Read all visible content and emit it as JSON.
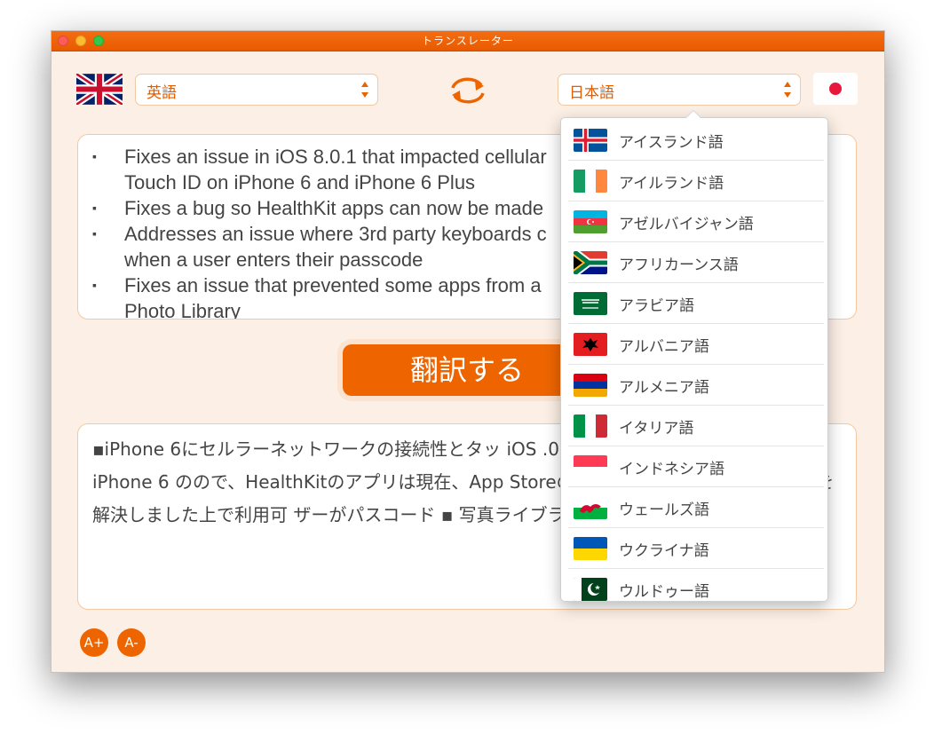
{
  "window": {
    "title": "トランスレーター"
  },
  "source_language": {
    "label": "英語",
    "flag_icon": "uk-flag-icon"
  },
  "target_language": {
    "label": "日本語",
    "flag_icon": "japan-flag-icon"
  },
  "source_text": {
    "lines": [
      {
        "bullet": "▪",
        "text": "Fixes an issue in iOS 8.0.1 that impacted cellular"
      },
      {
        "bullet": "",
        "text": "Touch ID on iPhone 6 and iPhone 6 Plus"
      },
      {
        "bullet": "▪",
        "text": "Fixes a bug so HealthKit apps can now be made"
      },
      {
        "bullet": "▪",
        "text": "Addresses an issue where 3rd party keyboards c"
      },
      {
        "bullet": "",
        "text": "when a user enters their passcode"
      },
      {
        "bullet": "▪",
        "text": "Fixes an issue that prevented some apps from a"
      },
      {
        "bullet": "",
        "text": "Photo Library"
      }
    ]
  },
  "translate_button": {
    "label": "翻訳する"
  },
  "output_text": {
    "text": "▪iPhone 6にセルラーネットワークの接続性とタッ iOS .0. での問題が修正されていますし、iPhone 6 のので、HealthKitのアプリは現在、App Storeの ▪ サ がなる可能性がある問題を解決しました上で利用可 ザーがパスコード ▪ 写真ライブラリ ▪ から写真にア リ"
  },
  "font_controls": {
    "increase": "A+",
    "decrease": "A-"
  },
  "language_dropdown": {
    "items": [
      {
        "name": "アイスランド語",
        "flag": "iceland"
      },
      {
        "name": "アイルランド語",
        "flag": "ireland"
      },
      {
        "name": "アゼルバイジャン語",
        "flag": "azerbaijan"
      },
      {
        "name": "アフリカーンス語",
        "flag": "south-africa"
      },
      {
        "name": "アラビア語",
        "flag": "saudi-arabia"
      },
      {
        "name": "アルバニア語",
        "flag": "albania"
      },
      {
        "name": "アルメニア語",
        "flag": "armenia"
      },
      {
        "name": "イタリア語",
        "flag": "italy"
      },
      {
        "name": "インドネシア語",
        "flag": "indonesia"
      },
      {
        "name": "ウェールズ語",
        "flag": "wales"
      },
      {
        "name": "ウクライナ語",
        "flag": "ukraine"
      },
      {
        "name": "ウルドゥー語",
        "flag": "pakistan"
      }
    ]
  },
  "colors": {
    "accent": "#ee6500",
    "window_bg": "#fcf0e6",
    "text": "#444444"
  }
}
